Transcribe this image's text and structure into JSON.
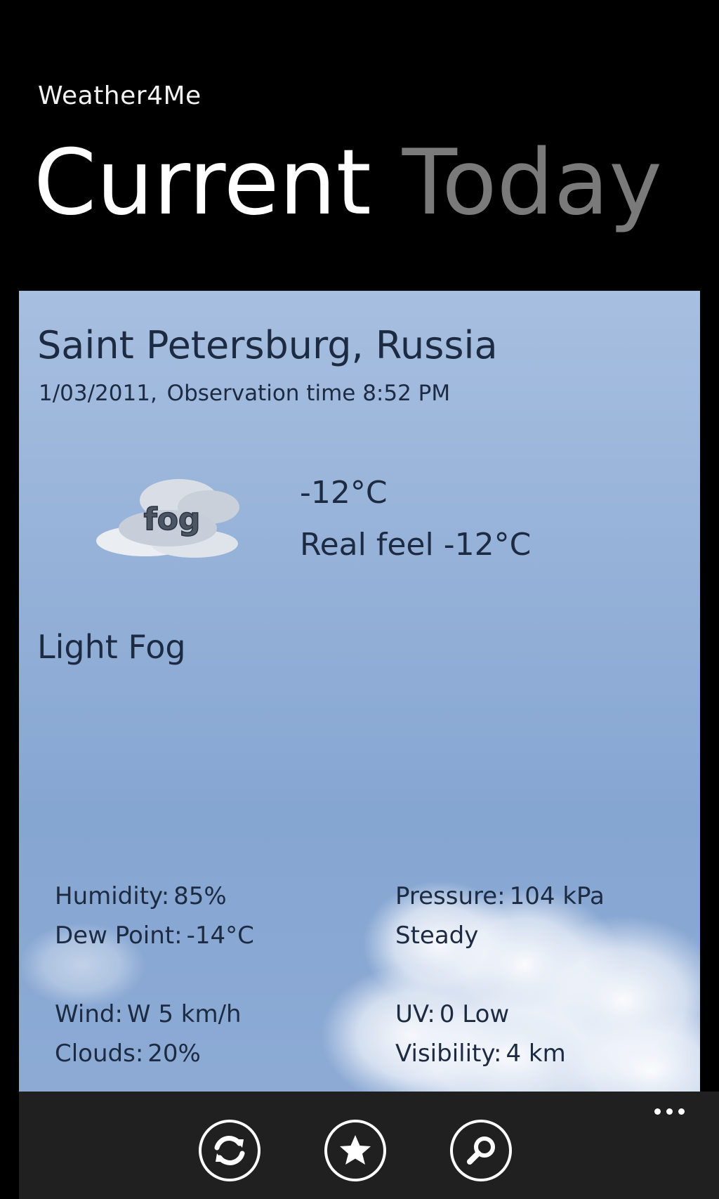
{
  "app": {
    "title": "Weather4Me"
  },
  "pivot": {
    "tabs": [
      {
        "label": "Current",
        "active": true
      },
      {
        "label": "Today",
        "active": false
      }
    ]
  },
  "current": {
    "location": "Saint Petersburg, Russia",
    "date": "1/03/2011,",
    "observation_label": "Observation time",
    "observation_time": "8:52 PM",
    "icon": "fog-icon",
    "icon_text": "fog",
    "temperature": "-12°C",
    "real_feel_label": "Real feel",
    "real_feel_value": "-12°C",
    "condition": "Light Fog",
    "stats": {
      "humidity_label": "Humidity:",
      "humidity_value": "85%",
      "dew_point_label": "Dew Point:",
      "dew_point_value": "-14°C",
      "pressure_label": "Pressure:",
      "pressure_value": "104 kPa",
      "pressure_trend": "Steady",
      "wind_label": "Wind:",
      "wind_value": "W 5 km/h",
      "clouds_label": "Clouds:",
      "clouds_value": "20%",
      "uv_label": "UV:",
      "uv_value": "0 Low",
      "visibility_label": "Visibility:",
      "visibility_value": "4 km"
    }
  },
  "app_bar": {
    "buttons": [
      {
        "icon": "refresh-icon"
      },
      {
        "icon": "star-icon"
      },
      {
        "icon": "search-icon"
      }
    ],
    "more": "more-ellipsis-icon"
  },
  "colors": {
    "background": "#000000",
    "panel_sky": "#95b1d8",
    "text_dark": "#1d2b42",
    "inactive_header": "#7a7a7a",
    "app_bar": "#202020"
  }
}
